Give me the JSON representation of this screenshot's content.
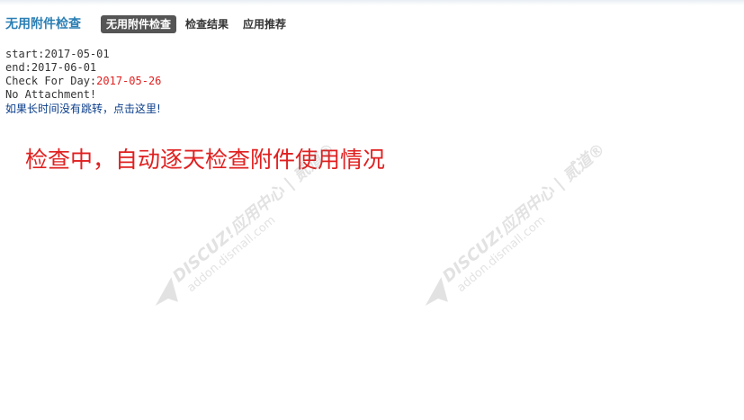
{
  "header": {
    "app_title": "无用附件检查",
    "tabs": [
      {
        "label": "无用附件检查",
        "active": true
      },
      {
        "label": "检查结果",
        "active": false
      },
      {
        "label": "应用推荐",
        "active": false
      }
    ]
  },
  "log": {
    "start": "start:2017-05-01",
    "end": "end:2017-06-01",
    "check_prefix": "Check For Day:",
    "check_day": "2017-05-26",
    "attachment_status": "No Attachment!",
    "redirect_link": "如果长时间没有跳转，点击这里!"
  },
  "status_message": "检查中，自动逐天检查附件使用情况",
  "watermark": {
    "line1": "DISCUZ!应用中心 | 贰道®",
    "line2": "addon.dismall.com"
  },
  "colors": {
    "title": "#2b7fb4",
    "active_tab_bg": "#555555",
    "highlight_red": "#e02020",
    "link": "#0a3d8a"
  }
}
